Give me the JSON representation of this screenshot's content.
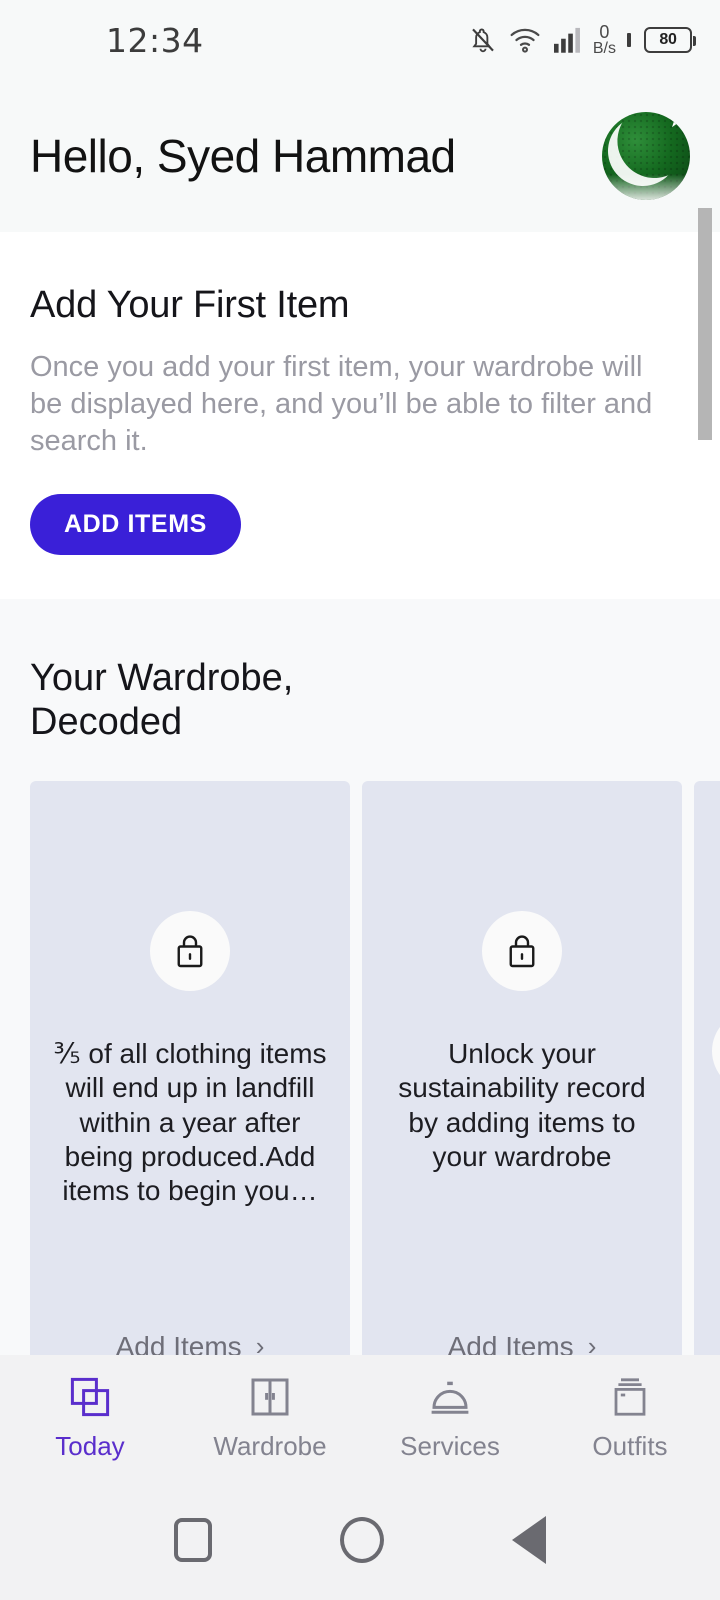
{
  "statusbar": {
    "time": "12:34",
    "net_speed_value": "0",
    "net_speed_unit": "B/s",
    "battery_level": "80",
    "icons": [
      "bell-muted-icon",
      "wifi-icon",
      "cellular-signal-icon",
      "battery-icon"
    ]
  },
  "header": {
    "greeting": "Hello, Syed Hammad",
    "avatar_alt": "user-avatar"
  },
  "first_item": {
    "title": "Add Your First Item",
    "body": "Once you add your first item, your wardrobe will be displayed here, and you’ll be able to filter and search it.",
    "button_label": "ADD ITEMS"
  },
  "wardrobe_section": {
    "title": "Your Wardrobe,\nDecoded",
    "cards": [
      {
        "icon": "lock-icon",
        "text": "⅗ of all clothing items will end up in landfill within a year after being produced.Add items to begin you…",
        "link_label": "Add Items",
        "chevron": "›"
      },
      {
        "icon": "lock-icon",
        "text": "Unlock your sustainability record by adding items to your wardrobe",
        "link_label": "Add Items",
        "chevron": "›"
      }
    ]
  },
  "tabbar": {
    "items": [
      {
        "label": "Today",
        "icon": "overlapping-squares-icon",
        "active": true
      },
      {
        "label": "Wardrobe",
        "icon": "wardrobe-closet-icon",
        "active": false
      },
      {
        "label": "Services",
        "icon": "service-bell-icon",
        "active": false
      },
      {
        "label": "Outfits",
        "icon": "stacked-cards-icon",
        "active": false
      }
    ]
  },
  "android_nav": {
    "recents": "recents-button",
    "home": "home-button",
    "back": "back-button"
  },
  "colors": {
    "accent": "#3a20d8",
    "tab_active": "#5a2ecc",
    "card_bg": "#E2E5F0",
    "page_bg": "#F8F9FA",
    "muted_text": "#9a9aa3"
  }
}
